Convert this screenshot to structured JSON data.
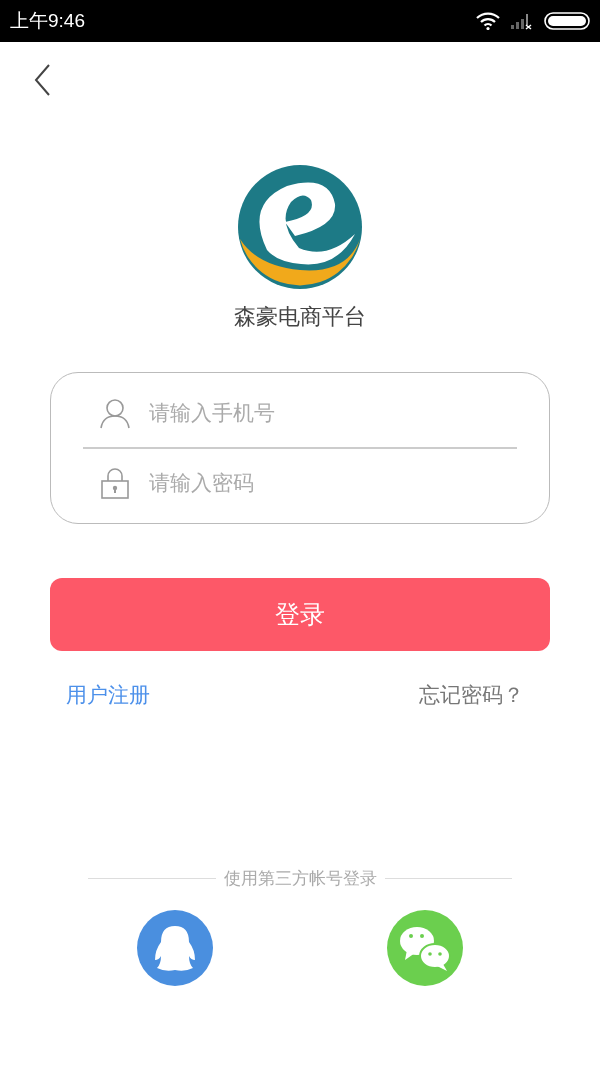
{
  "status_bar": {
    "time": "上午9:46"
  },
  "brand": {
    "name": "森豪电商平台"
  },
  "form": {
    "fields": [
      {
        "kind": "phone",
        "placeholder": "请输入手机号"
      },
      {
        "kind": "password",
        "placeholder": "请输入密码"
      }
    ]
  },
  "login_button": "登录",
  "links": {
    "register": "用户注册",
    "forgot": "忘记密码？"
  },
  "third_party": {
    "label": "使用第三方帐号登录",
    "options": [
      {
        "kind": "qq"
      },
      {
        "kind": "wechat"
      }
    ]
  }
}
